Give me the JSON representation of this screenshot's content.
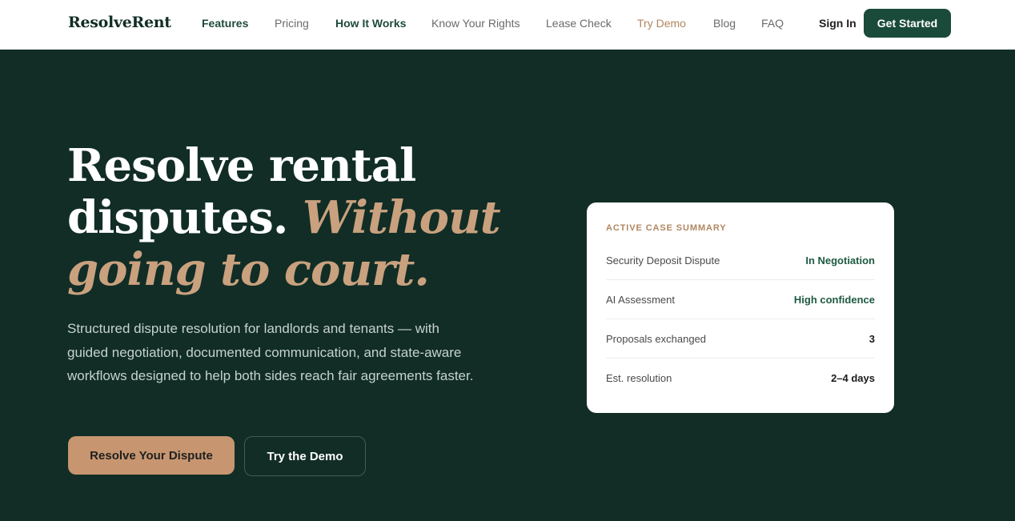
{
  "nav": {
    "logo": "ResolveRent",
    "links": [
      "Features",
      "Pricing",
      "How It Works",
      "Know Your Rights",
      "Lease Check",
      "Try Demo",
      "Blog",
      "FAQ"
    ],
    "sign_in": "Sign In",
    "cta": "Get Started"
  },
  "hero": {
    "title_line1": "Resolve rental",
    "title_line2a": "disputes.",
    "title_line2b": "Without",
    "title_line3": "going to court.",
    "subtitle": "Structured dispute resolution for landlords and tenants — with guided negotiation, documented communication, and state-aware workflows designed to help both sides reach fair agreements faster.",
    "primary_button": "Resolve Your Dispute",
    "secondary_button": "Try the Demo"
  },
  "card": {
    "heading": "ACTIVE CASE SUMMARY",
    "rows": [
      {
        "label": "Security Deposit Dispute",
        "value": "In Negotiation"
      },
      {
        "label": "AI Assessment",
        "value": "High confidence"
      },
      {
        "label": "Proposals exchanged",
        "value": "3"
      },
      {
        "label": "Est. resolution",
        "value": "2–4 days"
      }
    ]
  },
  "colors": {
    "background": "#112d26",
    "accent": "#c9a17e",
    "brand_green": "#1a4a39"
  }
}
